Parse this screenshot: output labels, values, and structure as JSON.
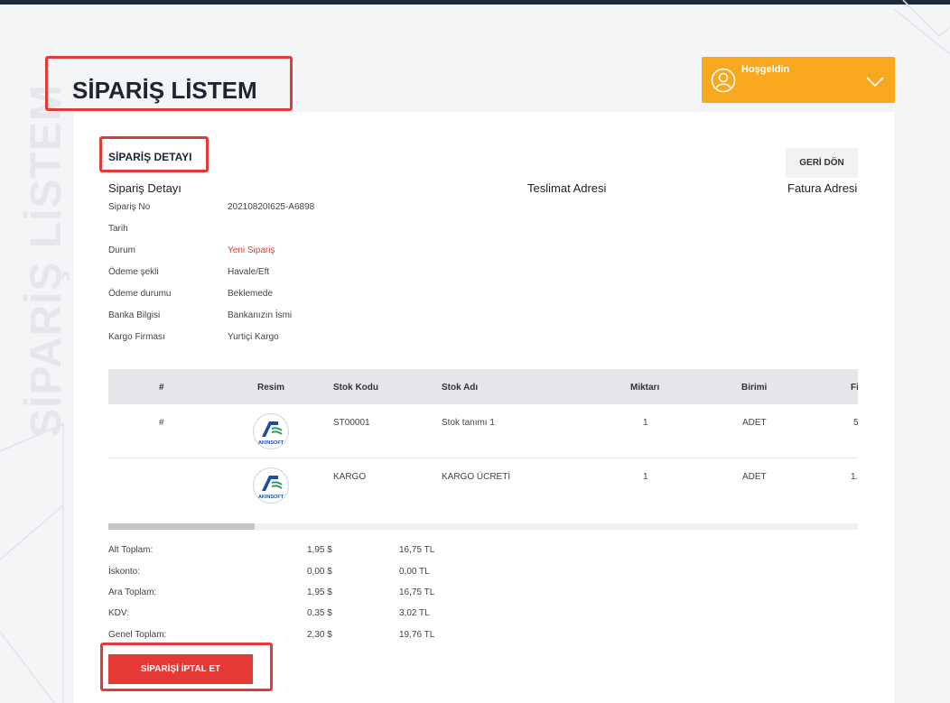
{
  "page": {
    "title": "SİPARİŞ LİSTEM",
    "watermark": "SİPARİŞ LİSTEM"
  },
  "user_menu": {
    "greeting": "Hoşgeldin"
  },
  "detail": {
    "section_title": "SİPARİŞ DETAYI",
    "back_button": "GERİ DÖN",
    "col_order": "Sipariş Detayı",
    "col_delivery": "Teslimat Adresi",
    "col_invoice": "Fatura Adresi",
    "fields": [
      {
        "label": "Sipariş No",
        "value": "20210820I625-A6898"
      },
      {
        "label": "Tarih",
        "value": ""
      },
      {
        "label": "Durum",
        "value": "Yeni Sipariş"
      },
      {
        "label": "Ödeme şekli",
        "value": "Havale/Eft"
      },
      {
        "label": "Ödeme durumu",
        "value": "Beklemede"
      },
      {
        "label": "Banka Bilgisi",
        "value": "Bankanızın İsmi"
      },
      {
        "label": "Kargo Firması",
        "value": "Yurtiçi Kargo"
      }
    ]
  },
  "table": {
    "headers": [
      "#",
      "Resim",
      "Stok Kodu",
      "Stok Adı",
      "Miktarı",
      "Birimi",
      "Fi"
    ],
    "rows": [
      {
        "num": "#",
        "code": "ST00001",
        "name": "Stok tanımı 1",
        "qty": "1",
        "unit": "ADET",
        "price": "5"
      },
      {
        "num": "",
        "code": "KARGO",
        "name": "KARGO ÜCRETİ",
        "qty": "1",
        "unit": "ADET",
        "price": "1."
      }
    ],
    "logo_text": "AKINSOFT",
    "scroll_fraction": 0.195
  },
  "totals": [
    {
      "label": "Alt Toplam:",
      "usd": "1,95 $",
      "tl": "16,75 TL"
    },
    {
      "label": "İskonto:",
      "usd": "0,00 $",
      "tl": "0,00 TL"
    },
    {
      "label": "Ara Toplam:",
      "usd": "1,95 $",
      "tl": "16,75 TL"
    },
    {
      "label": "KDV:",
      "usd": "0,35 $",
      "tl": "3,02 TL"
    },
    {
      "label": "Genel Toplam:",
      "usd": "2,30 $",
      "tl": "19,76 TL"
    }
  ],
  "cancel_button": "SİPARİŞİ İPTAL ET",
  "colors": {
    "accent": "#f8a81f",
    "danger": "#e53935",
    "header_bg": "#1d2a3a"
  }
}
